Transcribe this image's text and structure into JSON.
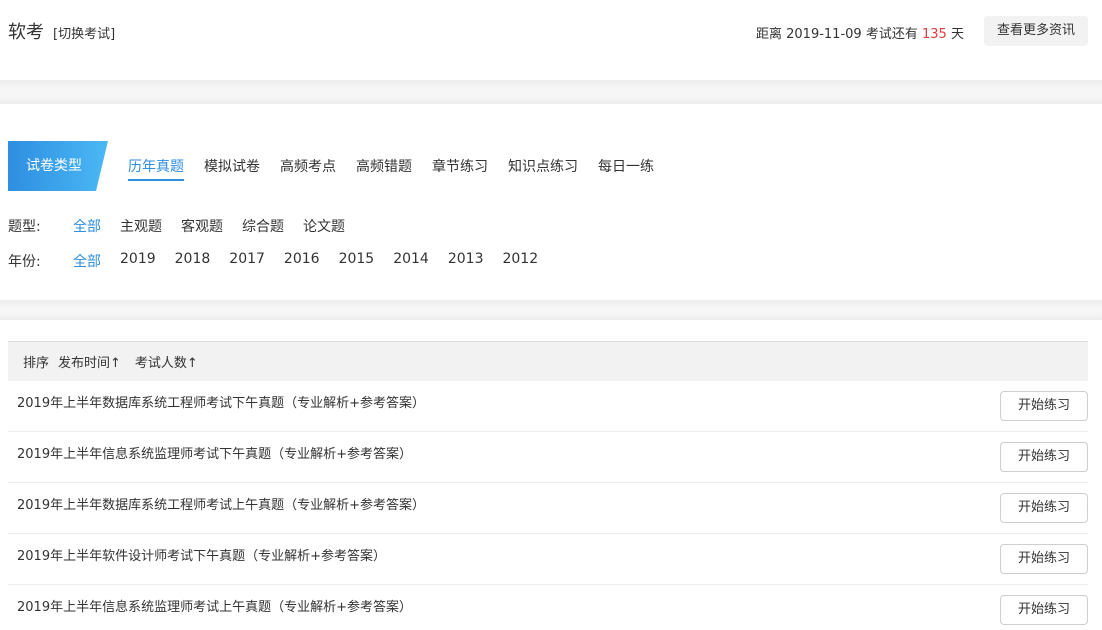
{
  "header": {
    "title": "软考",
    "switch_label": "[切换考试]",
    "countdown_prefix": "距离 2019-11-09 考试还有",
    "countdown_days": "135",
    "countdown_suffix": "天",
    "more_news_label": "查看更多资讯"
  },
  "paper_type": {
    "badge_label": "试卷类型",
    "tabs": [
      "历年真题",
      "模拟试卷",
      "高频考点",
      "高频错题",
      "章节练习",
      "知识点练习",
      "每日一练"
    ],
    "active_tab": "历年真题"
  },
  "filters": {
    "question_type": {
      "label": "题型:",
      "options": [
        "全部",
        "主观题",
        "客观题",
        "综合题",
        "论文题"
      ],
      "active": "全部"
    },
    "year": {
      "label": "年份:",
      "options": [
        "全部",
        "2019",
        "2018",
        "2017",
        "2016",
        "2015",
        "2014",
        "2013",
        "2012"
      ],
      "active": "全部"
    }
  },
  "sort": {
    "label": "排序",
    "options": [
      "发布时间↑",
      "考试人数↑"
    ]
  },
  "papers": [
    {
      "title": "2019年上半年数据库系统工程师考试下午真题（专业解析+参考答案）",
      "action": "开始练习"
    },
    {
      "title": "2019年上半年信息系统监理师考试下午真题（专业解析+参考答案）",
      "action": "开始练习"
    },
    {
      "title": "2019年上半年数据库系统工程师考试上午真题（专业解析+参考答案）",
      "action": "开始练习"
    },
    {
      "title": "2019年上半年软件设计师考试下午真题（专业解析+参考答案）",
      "action": "开始练习"
    },
    {
      "title": "2019年上半年信息系统监理师考试上午真题（专业解析+参考答案）",
      "action": "开始练习"
    }
  ],
  "colors": {
    "accent": "#2e8ee0",
    "countdown_highlight": "#e4393c",
    "badge_gradient_start": "#2e8ee0",
    "badge_gradient_end": "#4bb8f5"
  }
}
